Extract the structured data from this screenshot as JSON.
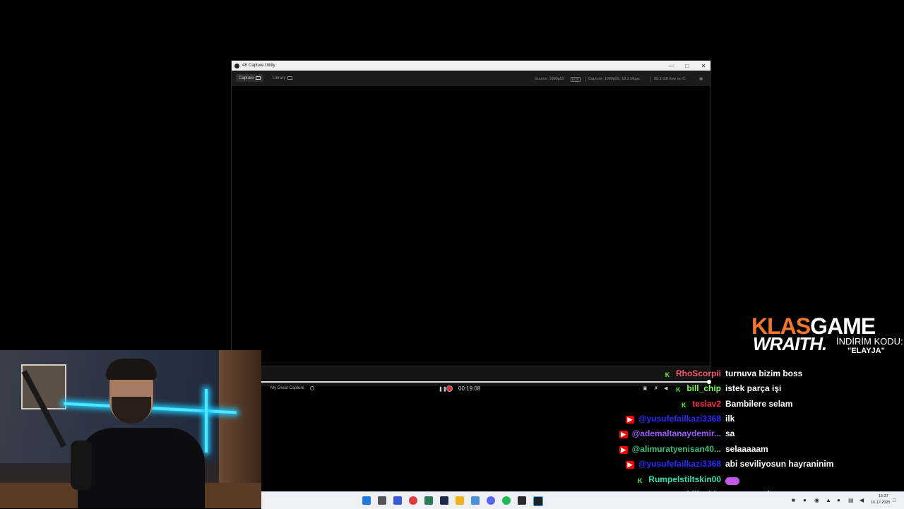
{
  "window": {
    "title": "4K Capture Utility",
    "minimize_icon": "minimize-icon",
    "maximize_icon": "maximize-icon",
    "close_icon": "close-icon"
  },
  "toolbar": {
    "tab_capture": "Capture",
    "tab_library": "Library",
    "source_label": "Source: 1080p59",
    "source_badge": "HDR",
    "capture_label": "Capture: 1080p59, 18.3 Mbps",
    "disk_free": "89.1 GB free on C:"
  },
  "player": {
    "capture_name": "My Great Capture",
    "timecode": "00:19:08",
    "progress": 1.0
  },
  "sponsor": {
    "brand_part1": "KLAS",
    "brand_part2": "GAME",
    "product": "WRAITH.",
    "discount_label": "İNDİRİM KODU:",
    "discount_code": "\"ELAYJA\""
  },
  "chat": [
    {
      "platform": "kick",
      "user": "RhoScorpii",
      "color": "#ff5a7a",
      "message": "turnuva bizim boss"
    },
    {
      "platform": "kick",
      "user": "bill_chip",
      "color": "#7cff4a",
      "message": "istek parça işi"
    },
    {
      "platform": "kick",
      "user": "teslav2",
      "color": "#ff2d4b",
      "message": "Bambilere selam"
    },
    {
      "platform": "youtube",
      "user": "@yusufefailkazi3368",
      "color": "#2a2aff",
      "message": "ilk"
    },
    {
      "platform": "youtube",
      "user": "@ademaltanaydemir...",
      "color": "#9b59ff",
      "message": "sa"
    },
    {
      "platform": "youtube",
      "user": "@alimuratyenisan40...",
      "color": "#3fbf7f",
      "message": "selaaaaam"
    },
    {
      "platform": "youtube",
      "user": "@yusufefailkazi3368",
      "color": "#2a2aff",
      "message": "abi seviliyosun hayraninim"
    },
    {
      "platform": "kick",
      "user": "Rumpelstiltskin00",
      "color": "#2fe0b0",
      "message": ""
    },
    {
      "platform": "kick",
      "user": "bill_chip",
      "color": "#7cff4a",
      "message": "arena mı abo"
    }
  ],
  "taskbar": {
    "clock_time": "16:37",
    "clock_date": "10.12.2025"
  },
  "colors": {
    "accent_orange": "#f2772a",
    "neon_cyan": "#4de8ff",
    "record_red": "#dd3333"
  }
}
